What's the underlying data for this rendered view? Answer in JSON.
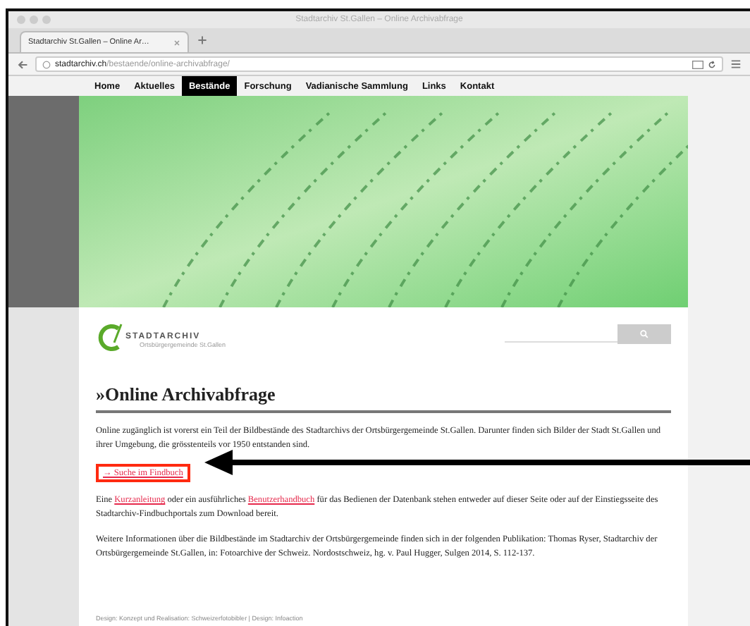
{
  "window": {
    "title": "Stadtarchiv St.Gallen – Online Archivabfrage"
  },
  "tabs": [
    {
      "label": "Stadtarchiv St.Gallen – Online Ar…",
      "selected": true
    }
  ],
  "address_bar": {
    "domain": "stadtarchiv.ch",
    "path": "/bestaende/online-archivabfrage/"
  },
  "nav": [
    {
      "label": "Home",
      "selected": false
    },
    {
      "label": "Aktuelles",
      "selected": false
    },
    {
      "label": "Bestände",
      "selected": true
    },
    {
      "label": "Forschung",
      "selected": false
    },
    {
      "label": "Vadianische Sammlung",
      "selected": false
    },
    {
      "label": "Links",
      "selected": false
    },
    {
      "label": "Kontakt",
      "selected": false
    }
  ],
  "logo": {
    "name": "STADTARCHIV",
    "subtitle": "Ortsbürgergemeinde St.Gallen"
  },
  "heading": "»Online Archivabfrage",
  "paragraphs": [
    {
      "kind": "text",
      "parts": [
        {
          "kind": "text",
          "text": "Online zugänglich ist vorerst ein Teil der Bildbestände des Stadtarchivs der Ortsbürgergemeinde St.Gallen. Darunter finden sich Bilder der Stadt St.Gallen und ihrer Umgebung, die grösstenteils vor 1950 entstanden sind."
        }
      ]
    },
    {
      "kind": "highlighted_link",
      "parts": [
        {
          "kind": "link",
          "text": "→ Suche im Findbuch"
        }
      ]
    },
    {
      "kind": "text",
      "parts": [
        {
          "kind": "text",
          "text": "Eine "
        },
        {
          "kind": "link",
          "text": "Kurzanleitung"
        },
        {
          "kind": "text",
          "text": " oder ein ausführliches "
        },
        {
          "kind": "link",
          "text": "Benutzerhandbuch"
        },
        {
          "kind": "text",
          "text": " für das Bedienen der Datenbank stehen entweder auf dieser Seite oder auf der Einstiegsseite des Stadtarchiv-Findbuchportals zum Download bereit."
        }
      ]
    },
    {
      "kind": "text",
      "parts": [
        {
          "kind": "text",
          "text": "Weitere Informationen über die Bildbestände im Stadtarchiv der Ortsbürgergemeinde finden sich in der folgenden Publikation: Thomas Ryser, Stadtarchiv der Ortsbürgergemeinde St.Gallen, in: Fotoarchive der Schweiz. Nordostschweiz, hg. v. Paul Hugger, Sulgen 2014, S. 112-137."
        }
      ]
    }
  ],
  "footer": "Design: Konzept und Realisation: Schweizerfotobibler | Design: Infoaction"
}
